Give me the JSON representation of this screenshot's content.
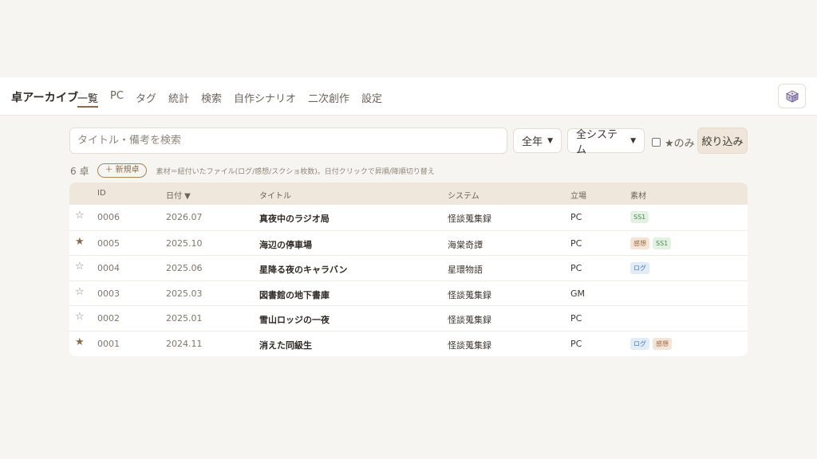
{
  "app": {
    "title": "卓アーカイブ"
  },
  "nav": [
    {
      "label": "一覧",
      "active": true
    },
    {
      "label": "PC",
      "active": false
    },
    {
      "label": "タグ",
      "active": false
    },
    {
      "label": "統計",
      "active": false
    },
    {
      "label": "検索",
      "active": false
    },
    {
      "label": "自作シナリオ",
      "active": false
    },
    {
      "label": "二次創作",
      "active": false
    },
    {
      "label": "設定",
      "active": false
    }
  ],
  "search": {
    "placeholder": "タイトル・備考を検索",
    "year_select": "全年",
    "system_select": "全システム",
    "star_only_label": "★のみ",
    "filter_button": "絞り込み"
  },
  "summary": {
    "count": "6 卓",
    "new_button": "＋ 新規卓",
    "hint": "素材＝紐付いたファイル(ログ/感想/スクショ枚数)。日付クリックで昇順/降順切り替え"
  },
  "table": {
    "headers": {
      "id": "ID",
      "date": "日付 ▼",
      "title": "タイトル",
      "system": "システム",
      "role": "立場",
      "materials": "素材"
    },
    "rows": [
      {
        "starred": false,
        "star": "☆",
        "id": "0006",
        "date": "2026.07",
        "title": "真夜中のラジオ局",
        "system": "怪談蒐集録",
        "role": "PC",
        "materials": [
          "SS1"
        ]
      },
      {
        "starred": true,
        "star": "★",
        "id": "0005",
        "date": "2025.10",
        "title": "海辺の停車場",
        "system": "海棠奇譚",
        "role": "PC",
        "materials": [
          "感想",
          "SS1"
        ]
      },
      {
        "starred": false,
        "star": "☆",
        "id": "0004",
        "date": "2025.06",
        "title": "星降る夜のキャラバン",
        "system": "星環物語",
        "role": "PC",
        "materials": [
          "ログ"
        ]
      },
      {
        "starred": false,
        "star": "☆",
        "id": "0003",
        "date": "2025.03",
        "title": "図書館の地下書庫",
        "system": "怪談蒐集録",
        "role": "GM",
        "materials": []
      },
      {
        "starred": false,
        "star": "☆",
        "id": "0002",
        "date": "2025.01",
        "title": "雪山ロッジの一夜",
        "system": "怪談蒐集録",
        "role": "PC",
        "materials": []
      },
      {
        "starred": true,
        "star": "★",
        "id": "0001",
        "date": "2024.11",
        "title": "消えた同級生",
        "system": "怪談蒐集録",
        "role": "PC",
        "materials": [
          "ログ",
          "感想"
        ]
      }
    ]
  },
  "icons": {
    "dice": "dice-icon",
    "chevron": "chevron-down-icon"
  },
  "colors": {
    "accent": "#8a6a4a",
    "header_bg": "#efe7dc",
    "page_bg": "#f7f5f1"
  }
}
